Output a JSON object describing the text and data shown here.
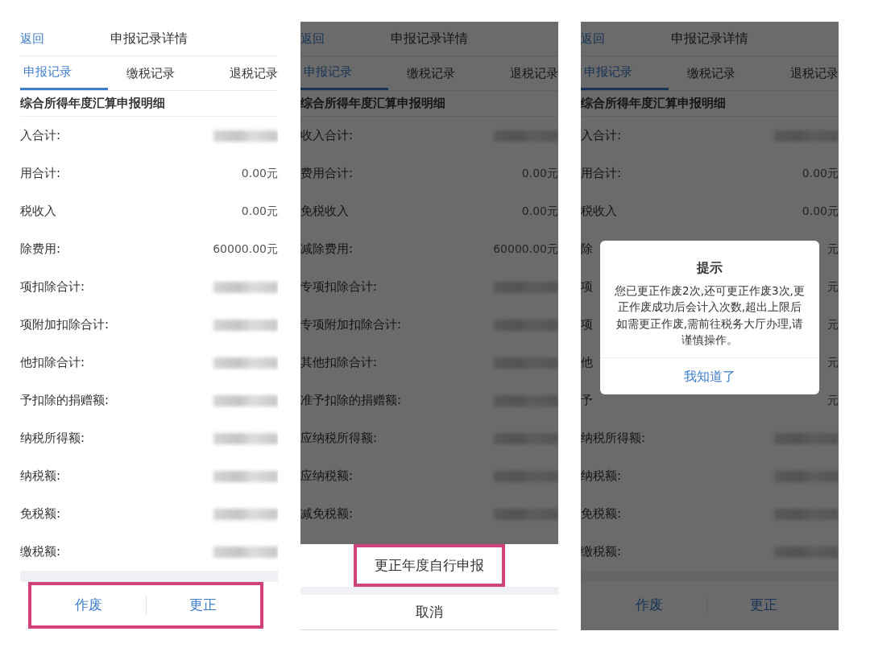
{
  "panels": [
    {
      "kind": "plain",
      "back": "返回",
      "title": "申报记录详情",
      "tabs": [
        {
          "label": "申报记录",
          "selected": true
        },
        {
          "label": "缴税记录",
          "selected": false
        },
        {
          "label": "退税记录",
          "selected": false
        }
      ],
      "section_title": "综合所得年度汇算申报明细",
      "rows": [
        {
          "label": "入合计:",
          "redacted": true
        },
        {
          "label": "用合计:",
          "value": "0.00元",
          "redacted": false
        },
        {
          "label": "税收入",
          "value": "0.00元",
          "redacted": false
        },
        {
          "label": "除费用:",
          "value": "60000.00元",
          "redacted": false
        },
        {
          "label": "项扣除合计:",
          "redacted": true
        },
        {
          "label": "项附加扣除合计:",
          "redacted": true
        },
        {
          "label": "他扣除合计:",
          "redacted": true
        },
        {
          "label": "予扣除的捐赠额:",
          "redacted": true
        },
        {
          "label": "纳税所得额:",
          "redacted": true
        },
        {
          "label": "纳税额:",
          "redacted": true
        },
        {
          "label": "免税额:",
          "redacted": true
        },
        {
          "label": "缴税额:",
          "redacted": true
        }
      ],
      "footer": {
        "highlighted": true,
        "buttons": [
          "作废",
          "更正"
        ]
      }
    },
    {
      "kind": "sheet",
      "back": "返回",
      "title": "申报记录详情",
      "tabs": [
        {
          "label": "申报记录",
          "selected": true
        },
        {
          "label": "缴税记录",
          "selected": false
        },
        {
          "label": "退税记录",
          "selected": false
        }
      ],
      "section_title": "综合所得年度汇算申报明细",
      "rows": [
        {
          "label": "收入合计:",
          "redacted": true
        },
        {
          "label": "费用合计:",
          "value": "0.00元",
          "redacted": false
        },
        {
          "label": "免税收入",
          "value": "0.00元",
          "redacted": false
        },
        {
          "label": "减除费用:",
          "value": "60000.00元",
          "redacted": false
        },
        {
          "label": "专项扣除合计:",
          "redacted": true
        },
        {
          "label": "专项附加扣除合计:",
          "redacted": true
        },
        {
          "label": "其他扣除合计:",
          "redacted": true
        },
        {
          "label": "准予扣除的捐赠额:",
          "redacted": true
        },
        {
          "label": "应纳税所得额:",
          "redacted": true
        },
        {
          "label": "应纳税额:",
          "redacted": true
        },
        {
          "label": "减免税额:",
          "redacted": true
        }
      ],
      "sheet": {
        "action": "更正年度自行申报",
        "highlighted": true,
        "cancel": "取消"
      }
    },
    {
      "kind": "dialog",
      "back": "返回",
      "title": "申报记录详情",
      "tabs": [
        {
          "label": "申报记录",
          "selected": true
        },
        {
          "label": "缴税记录",
          "selected": false
        },
        {
          "label": "退税记录",
          "selected": false
        }
      ],
      "section_title": "综合所得年度汇算申报明细",
      "rows": [
        {
          "label": "入合计:",
          "redacted": true
        },
        {
          "label": "用合计:",
          "value": "0.00元",
          "redacted": false
        },
        {
          "label": "税收入",
          "value": "0.00元",
          "redacted": false
        },
        {
          "label": "除",
          "value": "元",
          "redacted": false
        },
        {
          "label": "项",
          "value": "元",
          "redacted": false
        },
        {
          "label": "项",
          "value": "元",
          "redacted": false
        },
        {
          "label": "他",
          "value": "元",
          "redacted": false
        },
        {
          "label": "予",
          "value": "元",
          "redacted": false
        },
        {
          "label": "纳税所得额:",
          "redacted": true
        },
        {
          "label": "纳税额:",
          "redacted": true
        },
        {
          "label": "免税额:",
          "redacted": true
        },
        {
          "label": "缴税额:",
          "redacted": true
        }
      ],
      "footer": {
        "buttons": [
          "作废",
          "更正"
        ]
      },
      "dialog": {
        "title": "提示",
        "message": "您已更正作废2次,还可更正作废3次,更正作废成功后会计入次数,超出上限后如需更正作废,需前往税务大厅办理,请谨慎操作。",
        "button": "我知道了"
      }
    }
  ]
}
